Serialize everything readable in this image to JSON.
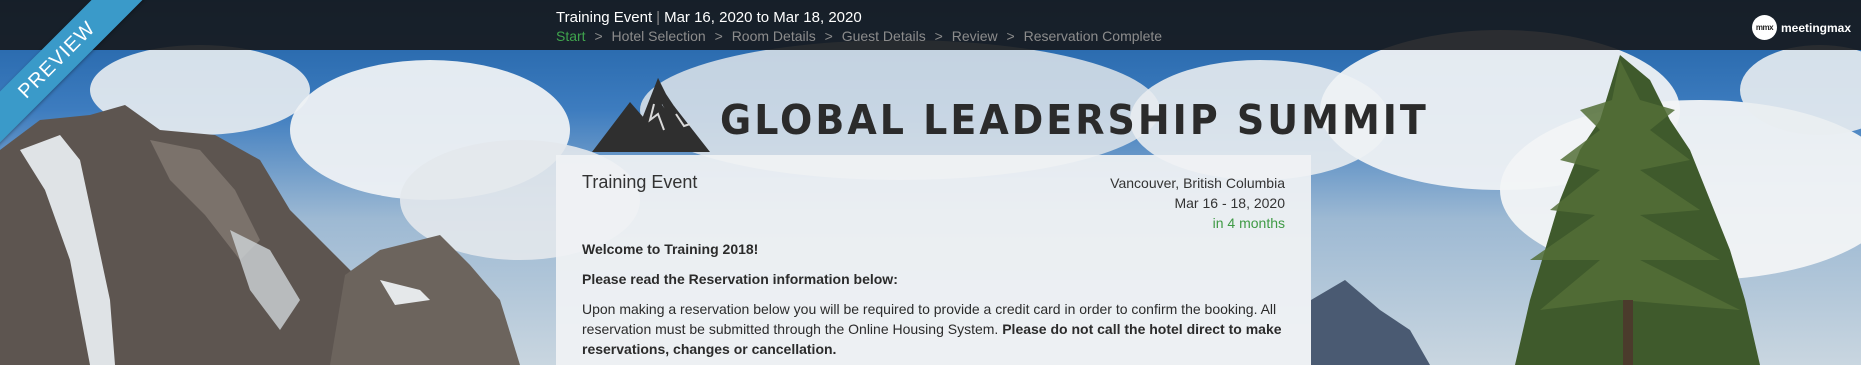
{
  "ribbon": {
    "label": "PREVIEW"
  },
  "topbar": {
    "event_name": "Training Event",
    "separator": "|",
    "date_range": "Mar 16, 2020 to Mar 18, 2020",
    "steps": [
      {
        "label": "Start",
        "active": true
      },
      {
        "label": "Hotel Selection",
        "active": false
      },
      {
        "label": "Room Details",
        "active": false
      },
      {
        "label": "Guest Details",
        "active": false
      },
      {
        "label": "Review",
        "active": false
      },
      {
        "label": "Reservation Complete",
        "active": false
      }
    ],
    "step_separator": ">",
    "brand": {
      "badge": "mmx",
      "name": "meetingmax",
      "icon": "meetingmax-logo-icon"
    }
  },
  "logo": {
    "icon": "mountain-logo-icon",
    "title": "GLOBAL LEADERSHIP SUMMIT"
  },
  "card": {
    "event_name": "Training Event",
    "location": "Vancouver, British Columbia",
    "dates": "Mar 16 - 18, 2020",
    "countdown": "in 4 months",
    "welcome": "Welcome to Training 2018!",
    "notice_title": "Please read the Reservation information below:",
    "notice_body": "Upon making a reservation below you will be required to provide a credit card in order to confirm the booking.  All reservation must be submitted through the Online Housing System.",
    "notice_warning": "Please do not call the hotel direct to make reservations, changes or cancellation."
  },
  "colors": {
    "topbar_bg": "#16181c",
    "active_step": "#3fa34d",
    "inactive_step": "#8c8c8c",
    "ribbon": "#3a9ac9",
    "countdown": "#3f9a45"
  }
}
